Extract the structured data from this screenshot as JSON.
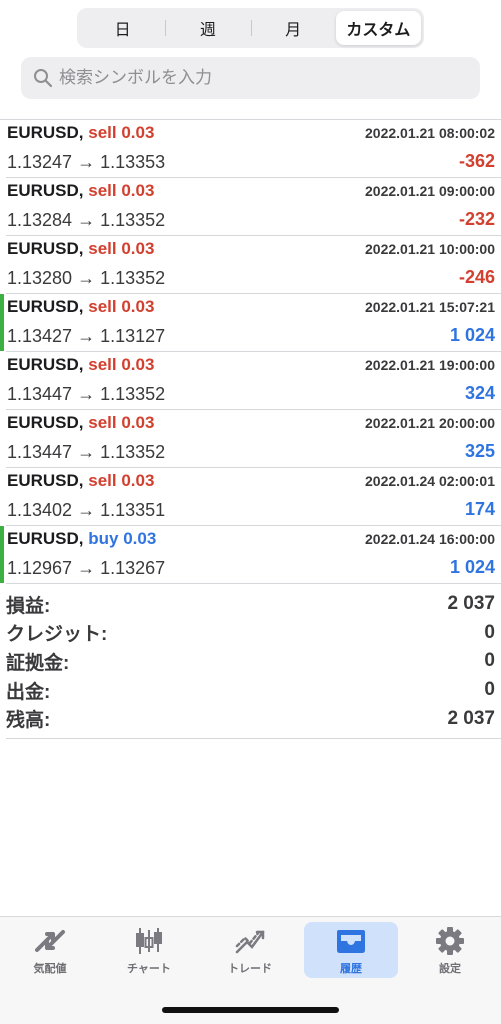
{
  "segments": [
    "日",
    "週",
    "月",
    "カスタム"
  ],
  "active_segment": "カスタム",
  "search": {
    "placeholder": "検索シンボルを入力"
  },
  "trades": [
    {
      "symbol": "EURUSD,",
      "side": "sell 0.03",
      "side_type": "sell",
      "time": "2022.01.21 08:00:02",
      "open": "1.13247",
      "arrow": "→",
      "close": "1.13353",
      "profit": "-362",
      "marked": false
    },
    {
      "symbol": "EURUSD,",
      "side": "sell 0.03",
      "side_type": "sell",
      "time": "2022.01.21 09:00:00",
      "open": "1.13284",
      "arrow": "→",
      "close": "1.13352",
      "profit": "-232",
      "marked": false
    },
    {
      "symbol": "EURUSD,",
      "side": "sell 0.03",
      "side_type": "sell",
      "time": "2022.01.21 10:00:00",
      "open": "1.13280",
      "arrow": "→",
      "close": "1.13352",
      "profit": "-246",
      "marked": false
    },
    {
      "symbol": "EURUSD,",
      "side": "sell 0.03",
      "side_type": "sell",
      "time": "2022.01.21 15:07:21",
      "open": "1.13427",
      "arrow": "→",
      "close": "1.13127",
      "profit": "1 024",
      "marked": true
    },
    {
      "symbol": "EURUSD,",
      "side": "sell 0.03",
      "side_type": "sell",
      "time": "2022.01.21 19:00:00",
      "open": "1.13447",
      "arrow": "→",
      "close": "1.13352",
      "profit": "324",
      "marked": false
    },
    {
      "symbol": "EURUSD,",
      "side": "sell 0.03",
      "side_type": "sell",
      "time": "2022.01.21 20:00:00",
      "open": "1.13447",
      "arrow": "→",
      "close": "1.13352",
      "profit": "325",
      "marked": false
    },
    {
      "symbol": "EURUSD,",
      "side": "sell 0.03",
      "side_type": "sell",
      "time": "2022.01.24 02:00:01",
      "open": "1.13402",
      "arrow": "→",
      "close": "1.13351",
      "profit": "174",
      "marked": false
    },
    {
      "symbol": "EURUSD,",
      "side": "buy 0.03",
      "side_type": "buy",
      "time": "2022.01.24 16:00:00",
      "open": "1.12967",
      "arrow": "→",
      "close": "1.13267",
      "profit": "1 024",
      "marked": true
    }
  ],
  "summary": [
    {
      "label": "損益:",
      "value": "2 037"
    },
    {
      "label": "クレジット:",
      "value": "0"
    },
    {
      "label": "証拠金:",
      "value": "0"
    },
    {
      "label": "出金:",
      "value": "0"
    },
    {
      "label": "残高:",
      "value": "2 037"
    }
  ],
  "tabs": [
    {
      "label": "気配値",
      "icon": "quotes-icon",
      "active": false
    },
    {
      "label": "チャート",
      "icon": "candlestick-chart-icon",
      "active": false
    },
    {
      "label": "トレード",
      "icon": "trade-icon",
      "active": false
    },
    {
      "label": "履歴",
      "icon": "history-tray-icon",
      "active": true
    },
    {
      "label": "設定",
      "icon": "gear-icon",
      "active": false
    }
  ],
  "colors": {
    "sell": "#d2402f",
    "buy": "#2f74e0",
    "negative": "#d2402f",
    "positive": "#2f74e0",
    "marker": "#3cb043",
    "active_tab_bg": "#cfe1fb"
  }
}
